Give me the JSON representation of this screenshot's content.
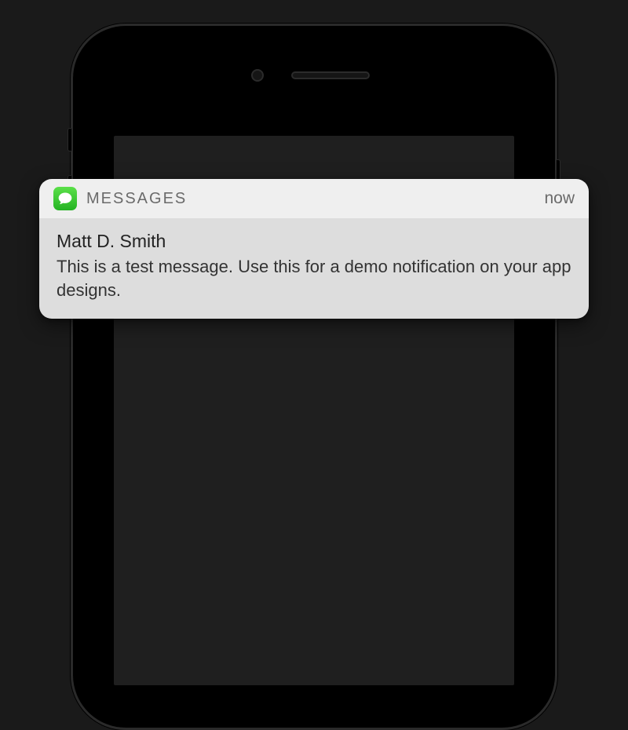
{
  "notification": {
    "app_name": "MESSAGES",
    "timestamp": "now",
    "sender": "Matt D. Smith",
    "message": "This is a test message. Use this for a demo notification on your app designs."
  }
}
